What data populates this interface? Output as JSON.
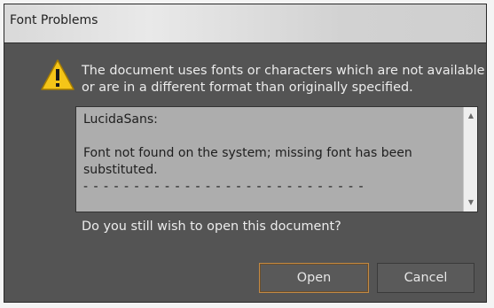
{
  "dialog": {
    "title": "Font Problems",
    "icon": "warning-icon",
    "message": "The document uses fonts or characters which are not available or are in a different format than originally specified.",
    "details": {
      "font_name": "LucidaSans:",
      "issue": "Font not found on the system; missing font has been substituted.",
      "separator": "- - - - - - - - - - - - - - - - - - - - - - - - - - - -"
    },
    "question": "Do you still wish to open this document?",
    "buttons": {
      "open": "Open",
      "cancel": "Cancel"
    },
    "colors": {
      "background": "#545454",
      "title_bar": "#dcdcdc",
      "details_background": "#adadad",
      "focus_border": "#c28a45",
      "warning_yellow": "#f5c518"
    }
  }
}
